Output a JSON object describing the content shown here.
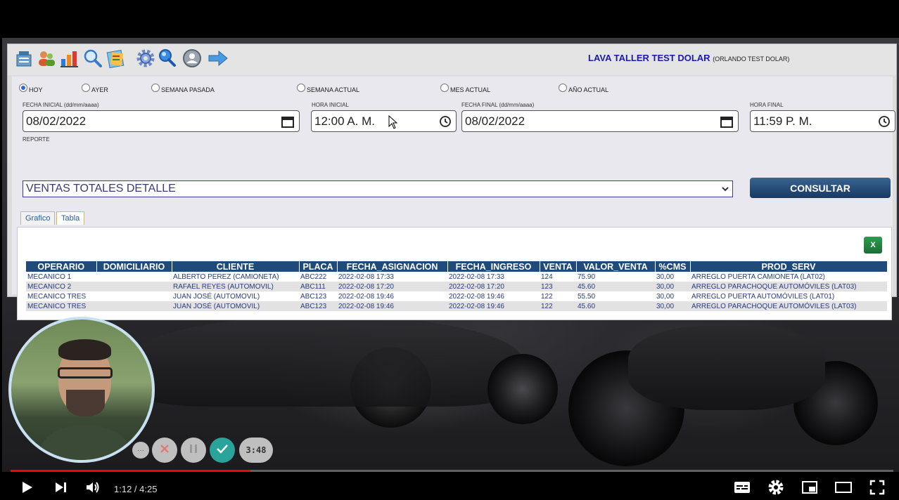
{
  "toolbar": {
    "icons": [
      "register-icon",
      "users-icon",
      "chart-icon",
      "search-icon",
      "report-icon",
      "gear-icon",
      "search2-icon",
      "user-profile-icon",
      "arrow-right-icon"
    ],
    "company_name": "LAVA TALLER TEST DOLAR",
    "company_user": "(ORLANDO TEST DOLAR)"
  },
  "periods": [
    {
      "label": "HOY",
      "checked": true
    },
    {
      "label": "AYER",
      "checked": false
    },
    {
      "label": "SEMANA PASADA",
      "checked": false
    },
    {
      "label": "SEMANA ACTUAL",
      "checked": false
    },
    {
      "label": "MES ACTUAL",
      "checked": false
    },
    {
      "label": "AÑO ACTUAL",
      "checked": false
    }
  ],
  "form": {
    "fecha_inicial_label": "FECHA INICIAL (dd/mm/aaaa)",
    "fecha_inicial": "08/02/2022",
    "hora_inicial_label": "HORA INICIAL",
    "hora_inicial": "12:00 A. M.",
    "fecha_final_label": "FECHA FINAL (dd/mm/aaaa)",
    "fecha_final": "08/02/2022",
    "hora_final_label": "HORA FINAL",
    "hora_final": "11:59 P. M.",
    "reporte_label": "REPORTE",
    "reporte": "VENTAS TOTALES DETALLE",
    "consultar": "CONSULTAR"
  },
  "tabs": [
    "Grafico",
    "Tabla"
  ],
  "active_tab": "Tabla",
  "excel_label": "X",
  "table": {
    "headers": [
      "OPERARIO",
      "DOMICILIARIO",
      "CLIENTE",
      "PLACA",
      "FECHA_ASIGNACION",
      "FECHA_INGRESO",
      "VENTA",
      "VALOR_VENTA",
      "%CMS",
      "PROD_SERV"
    ],
    "rows": [
      [
        "MECANICO 1",
        "",
        "ALBERTO PEREZ (CAMIONETA)",
        "ABC222",
        "2022-02-08 17:33",
        "2022-02-08 17:33",
        "124",
        "75.90",
        "30,00",
        "ARREGLO PUERTA CAMIONETA (LAT02)"
      ],
      [
        "MECANICO 2",
        "",
        "RAFAEL REYES (AUTOMOVIL)",
        "ABC111",
        "2022-02-08 17:20",
        "2022-02-08 17:20",
        "123",
        "45.60",
        "30,00",
        "ARREGLO PARACHOQUE AUTOMÓVILES (LAT03)"
      ],
      [
        "MECANICO TRES",
        "",
        "JUAN JOSÉ (AUTOMOVIL)",
        "ABC123",
        "2022-02-08 19:46",
        "2022-02-08 19:46",
        "122",
        "55.50",
        "30,00",
        "ARREGLO PUERTA AUTOMÓVILES (LAT01)"
      ],
      [
        "MECANICO TRES",
        "",
        "JUAN JOSÉ (AUTOMOVIL)",
        "ABC123",
        "2022-02-08 19:46",
        "2022-02-08 19:46",
        "122",
        "45.60",
        "30,00",
        "ARREGLO PARACHOQUE AUTOMÓVILES (LAT03)"
      ]
    ]
  },
  "recorder": {
    "more": "···",
    "timer": "3:48"
  },
  "player": {
    "time": "1:12 / 4:25",
    "progress": 0.272
  }
}
